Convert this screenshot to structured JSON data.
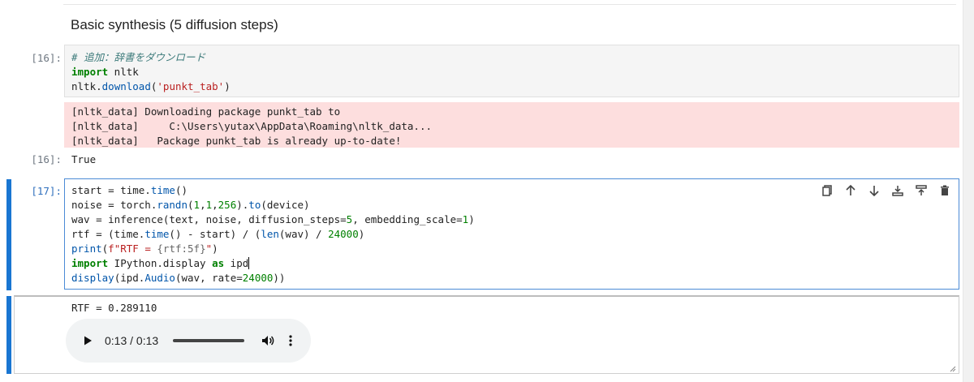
{
  "markdown": {
    "heading": "Basic synthesis (5 diffusion steps)"
  },
  "cell16": {
    "prompt": "[16]:",
    "output_prompt": "[16]:",
    "code": [
      "# 追加：辞書をダウンロード",
      "import nltk",
      "nltk.download('punkt_tab')"
    ],
    "stderr": [
      "[nltk_data] Downloading package punkt_tab to",
      "[nltk_data]     C:\\Users\\yutax\\AppData\\Roaming\\nltk_data...",
      "[nltk_data]   Package punkt_tab is already up-to-date!"
    ],
    "result": "True"
  },
  "cell17": {
    "prompt": "[17]:",
    "code": [
      "start = time.time()",
      "noise = torch.randn(1,1,256).to(device)",
      "wav = inference(text, noise, diffusion_steps=5, embedding_scale=1)",
      "rtf = (time.time() - start) / (len(wav) / 24000)",
      "print(f\"RTF = {rtf:5f}\")",
      "import IPython.display as ipd",
      "display(ipd.Audio(wav, rate=24000))"
    ],
    "toolbar": [
      "copy-icon",
      "move-up-icon",
      "move-down-icon",
      "insert-above-icon",
      "insert-below-icon",
      "delete-icon"
    ],
    "stdout": "RTF = 0.289110",
    "audio": {
      "time": "0:13 / 0:13",
      "progress": 1.0
    }
  }
}
